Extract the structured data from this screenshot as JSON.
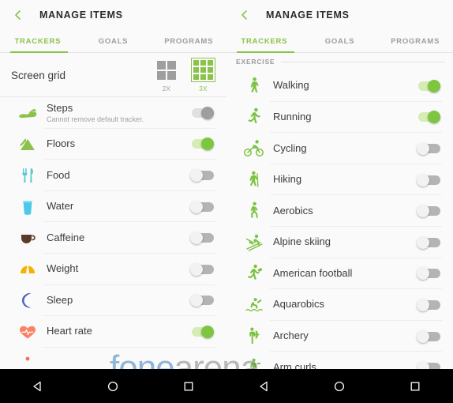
{
  "colors": {
    "accent_green": "#8bc34a",
    "toggle_on": "#7ec640",
    "toggle_on_track": "#d5ecb5",
    "toggle_off_track": "#b4b4b4",
    "screen_bg": "#fafafa",
    "navbar_bg": "#000000",
    "title_text": "#2b2b2b"
  },
  "left_screen": {
    "appbar": {
      "back_icon": "chevron-left-icon",
      "title": "MANAGE ITEMS"
    },
    "tabs": [
      {
        "label": "TRACKERS",
        "active": true
      },
      {
        "label": "GOALS",
        "active": false
      },
      {
        "label": "PROGRAMS",
        "active": false
      }
    ],
    "screen_grid": {
      "label": "Screen grid",
      "options": [
        {
          "caption": "2X",
          "icon": "grid-2x2-icon",
          "selected": false
        },
        {
          "caption": "3X",
          "icon": "grid-3x3-icon",
          "selected": true
        }
      ]
    },
    "items": [
      {
        "title": "Steps",
        "subtitle": "Cannot remove default tracker.",
        "icon": "shoe-icon",
        "toggle": "disabled"
      },
      {
        "title": "Floors",
        "subtitle": "",
        "icon": "mountain-icon",
        "toggle": "on"
      },
      {
        "title": "Food",
        "subtitle": "",
        "icon": "cutlery-icon",
        "toggle": "off"
      },
      {
        "title": "Water",
        "subtitle": "",
        "icon": "water-glass-icon",
        "toggle": "off"
      },
      {
        "title": "Caffeine",
        "subtitle": "",
        "icon": "coffee-cup-icon",
        "toggle": "off"
      },
      {
        "title": "Weight",
        "subtitle": "",
        "icon": "weight-scale-icon",
        "toggle": "off"
      },
      {
        "title": "Sleep",
        "subtitle": "",
        "icon": "crescent-moon-icon",
        "toggle": "off"
      },
      {
        "title": "Heart rate",
        "subtitle": "",
        "icon": "heart-pulse-icon",
        "toggle": "on"
      }
    ]
  },
  "right_screen": {
    "appbar": {
      "back_icon": "chevron-left-icon",
      "title": "MANAGE ITEMS"
    },
    "tabs": [
      {
        "label": "TRACKERS",
        "active": true
      },
      {
        "label": "GOALS",
        "active": false
      },
      {
        "label": "PROGRAMS",
        "active": false
      }
    ],
    "section_header": "EXERCISE",
    "items": [
      {
        "title": "Walking",
        "icon": "walking-icon",
        "toggle": "on"
      },
      {
        "title": "Running",
        "icon": "running-icon",
        "toggle": "on"
      },
      {
        "title": "Cycling",
        "icon": "cycling-icon",
        "toggle": "off"
      },
      {
        "title": "Hiking",
        "icon": "hiking-icon",
        "toggle": "off"
      },
      {
        "title": "Aerobics",
        "icon": "aerobics-icon",
        "toggle": "off"
      },
      {
        "title": "Alpine skiing",
        "icon": "skiing-icon",
        "toggle": "off"
      },
      {
        "title": "American football",
        "icon": "football-icon",
        "toggle": "off"
      },
      {
        "title": "Aquarobics",
        "icon": "aquarobics-icon",
        "toggle": "off"
      },
      {
        "title": "Archery",
        "icon": "archery-icon",
        "toggle": "off"
      },
      {
        "title": "Arm curls",
        "icon": "arm-curls-icon",
        "toggle": "off"
      }
    ]
  },
  "watermark": {
    "part1": "fone",
    "part2": "arena"
  },
  "navbar": {
    "buttons": [
      {
        "name": "back-nav-button",
        "icon": "triangle-left-icon"
      },
      {
        "name": "home-nav-button",
        "icon": "circle-icon"
      },
      {
        "name": "recents-nav-button",
        "icon": "square-icon"
      }
    ]
  }
}
